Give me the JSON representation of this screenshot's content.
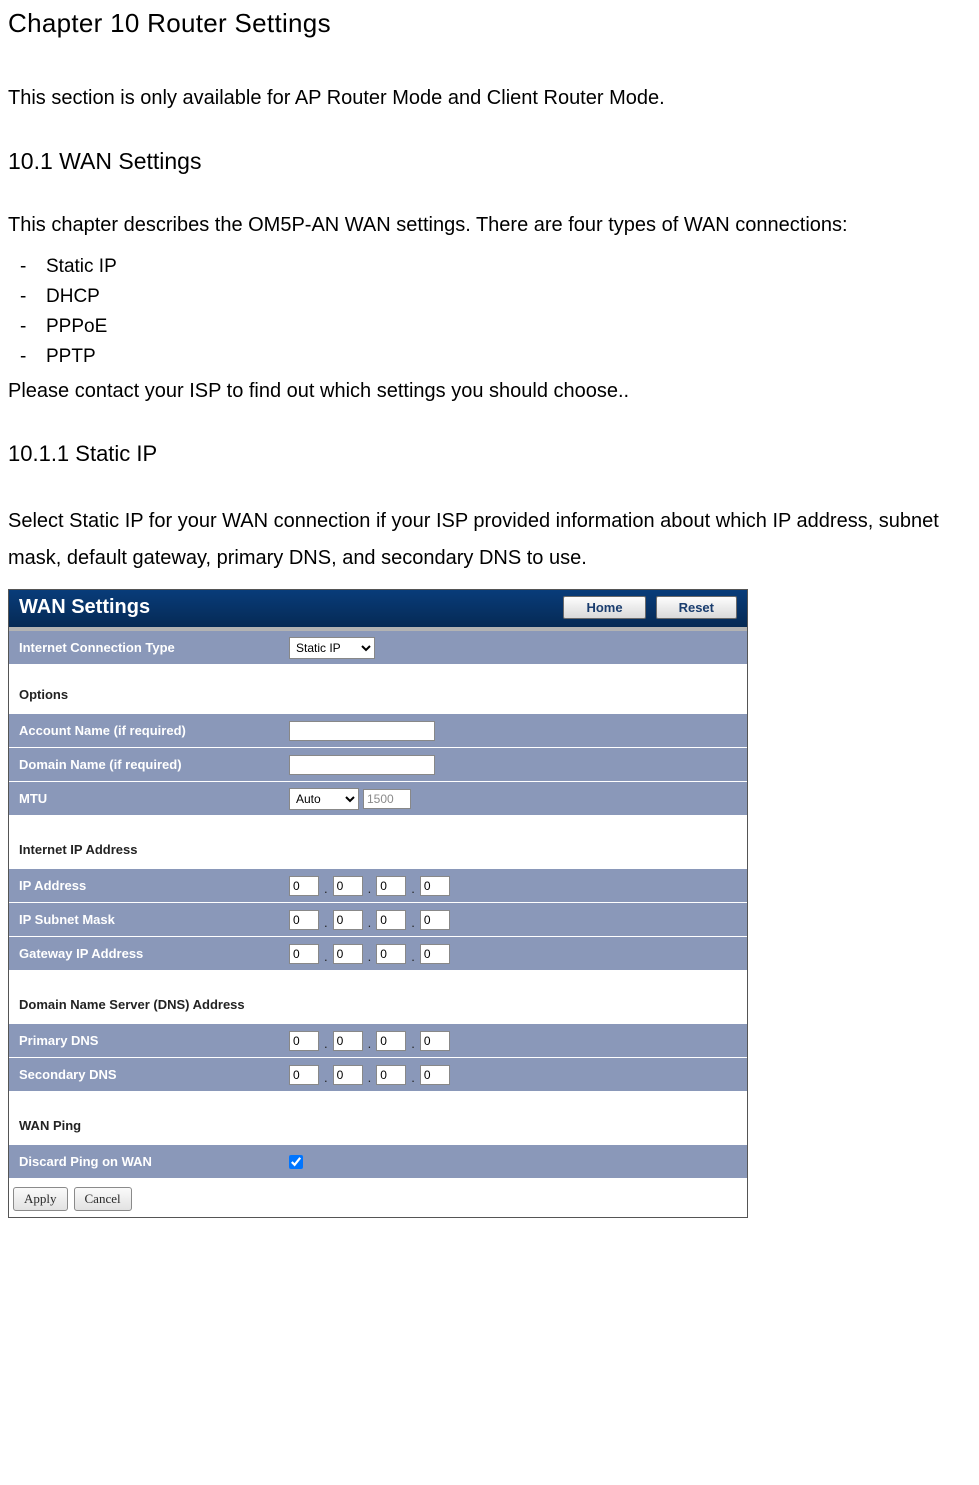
{
  "doc": {
    "h1": "Chapter 10 Router Settings",
    "intro_prefix": "This section is only available for ",
    "intro_mode1": "AP Router Mode",
    "intro_mid": " and C",
    "intro_mode2": "lient Router Mode",
    "intro_suffix": ".",
    "h2": "10.1 WAN Settings",
    "wan_desc": "This chapter describes the OM5P-AN WAN settings. There are four types of WAN connections:",
    "types": [
      "Static IP",
      "DHCP",
      "PPPoE",
      "PPTP"
    ],
    "contact": "Please contact your ISP to find out which settings you should choose..",
    "h3": "10.1.1 Static IP",
    "static_desc": "Select Static IP for your WAN connection if your ISP provided information about which IP address, subnet mask, default gateway, primary DNS, and secondary DNS to use."
  },
  "panel": {
    "title": "WAN Settings",
    "home_btn": "Home",
    "reset_btn": "Reset",
    "conn_type_label": "Internet Connection Type",
    "conn_type_value": "Static IP",
    "options_title": "Options",
    "account_label": "Account Name (if required)",
    "account_value": "",
    "domain_label": "Domain Name (if required)",
    "domain_value": "",
    "mtu_label": "MTU",
    "mtu_mode": "Auto",
    "mtu_value": "1500",
    "ip_section": "Internet IP Address",
    "ip_addr_label": "IP Address",
    "ip_addr": [
      "0",
      "0",
      "0",
      "0"
    ],
    "subnet_label": "IP Subnet Mask",
    "subnet": [
      "0",
      "0",
      "0",
      "0"
    ],
    "gateway_label": "Gateway IP Address",
    "gateway": [
      "0",
      "0",
      "0",
      "0"
    ],
    "dns_section": "Domain Name Server (DNS) Address",
    "pdns_label": "Primary DNS",
    "pdns": [
      "0",
      "0",
      "0",
      "0"
    ],
    "sdns_label": "Secondary DNS",
    "sdns": [
      "0",
      "0",
      "0",
      "0"
    ],
    "wanping_section": "WAN Ping",
    "discard_label": "Discard Ping on WAN",
    "discard_checked": true,
    "apply_btn": "Apply",
    "cancel_btn": "Cancel"
  }
}
